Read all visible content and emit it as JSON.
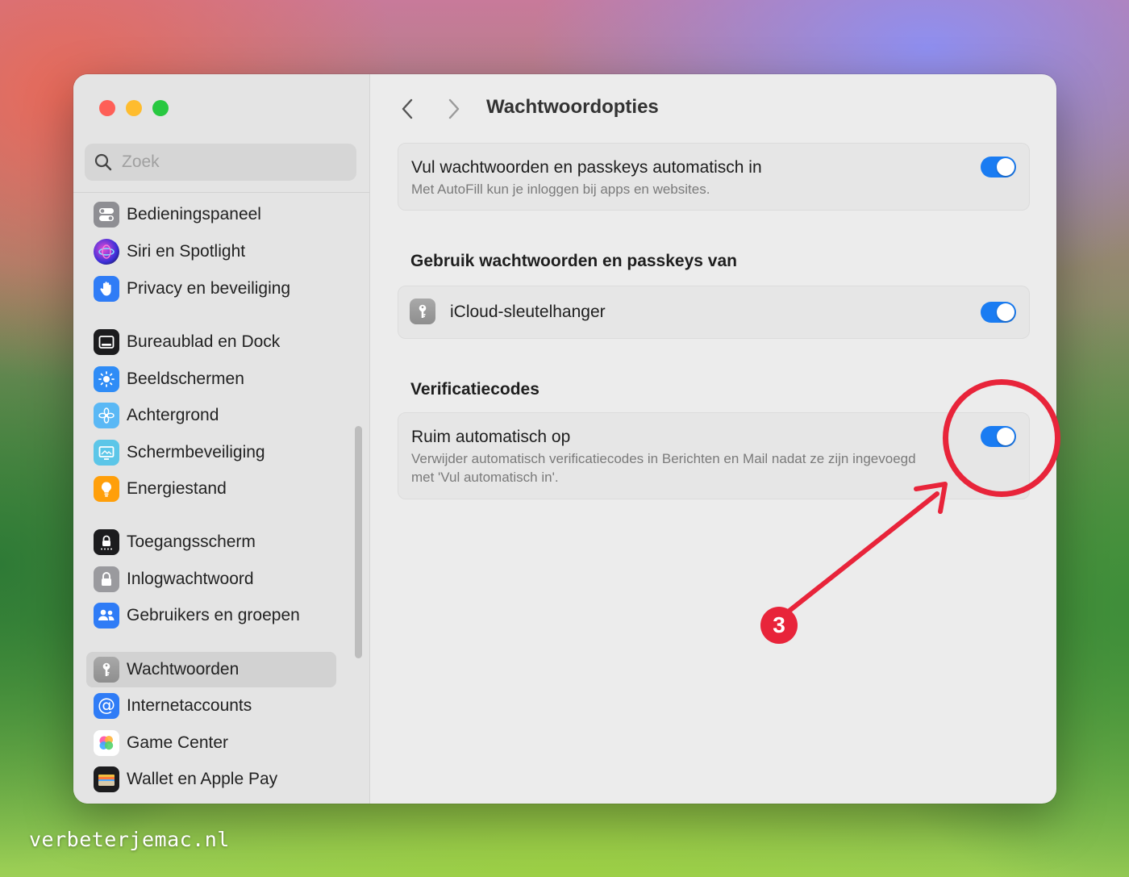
{
  "window": {
    "traffic_lights": [
      "close",
      "minimize",
      "zoom"
    ]
  },
  "sidebar": {
    "search": {
      "placeholder": "Zoek",
      "value": ""
    },
    "items": [
      {
        "label": "Bedieningspaneel",
        "icon": "control-center-icon",
        "color": "#8e8e93"
      },
      {
        "label": "Siri en Spotlight",
        "icon": "siri-icon",
        "color": "#5a3ad8"
      },
      {
        "label": "Privacy en beveiliging",
        "icon": "hand-icon",
        "color": "#2f7cf6"
      },
      {
        "label": "Bureaublad en Dock",
        "icon": "dock-icon",
        "color": "#1c1c1e"
      },
      {
        "label": "Beeldschermen",
        "icon": "sun-icon",
        "color": "#2f8cf6"
      },
      {
        "label": "Achtergrond",
        "icon": "flower-icon",
        "color": "#5ab8f5"
      },
      {
        "label": "Schermbeveiliging",
        "icon": "screensaver-icon",
        "color": "#5cc6e8"
      },
      {
        "label": "Energiestand",
        "icon": "lightbulb-icon",
        "color": "#ff9f0a"
      },
      {
        "label": "Toegangsscherm",
        "icon": "lock-screen-icon",
        "color": "#1c1c1e"
      },
      {
        "label": "Inlogwachtwoord",
        "icon": "lock-icon",
        "color": "#9a9a9e"
      },
      {
        "label": "Gebruikers en groepen",
        "icon": "users-icon",
        "color": "#2f7cf6"
      },
      {
        "label": "Wachtwoorden",
        "icon": "key-icon",
        "color": "#8e8e93",
        "selected": true
      },
      {
        "label": "Internetaccounts",
        "icon": "at-icon",
        "color": "#2f7cf6"
      },
      {
        "label": "Game Center",
        "icon": "game-center-icon",
        "color": "#ffffff"
      },
      {
        "label": "Wallet en Apple Pay",
        "icon": "wallet-icon",
        "color": "#1c1c1e"
      }
    ]
  },
  "main": {
    "title": "Wachtwoordopties",
    "autofill": {
      "title": "Vul wachtwoorden en passkeys automatisch in",
      "description": "Met AutoFill kun je inloggen bij apps en websites.",
      "enabled": true
    },
    "sources_section": {
      "title": "Gebruik wachtwoorden en passkeys van",
      "items": [
        {
          "label": "iCloud-sleutelhanger",
          "icon": "key-icon",
          "enabled": true
        }
      ]
    },
    "codes_section": {
      "title": "Verificatiecodes",
      "cleanup": {
        "title": "Ruim automatisch op",
        "description": "Verwijder automatisch verificatiecodes in Berichten en Mail nadat ze zijn ingevoegd met 'Vul automatisch in'.",
        "enabled": true
      }
    }
  },
  "annotation": {
    "badge": "3",
    "color": "#e8243a"
  },
  "watermark": "verbeterjemac.nl"
}
